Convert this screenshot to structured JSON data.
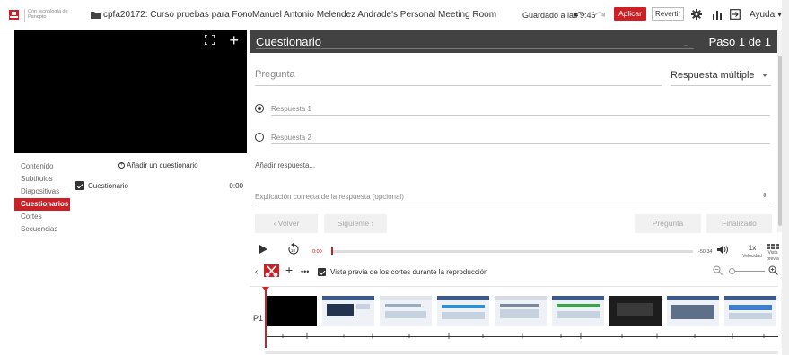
{
  "header": {
    "logo_text": "Con tecnología de Panopto",
    "folder": "cpfa20172: Curso pruebas para Fono",
    "separator": ">",
    "session": "Manuel Antonio Melendez Andrade's Personal Meeting Room",
    "saved_status": "Guardado a las 9:46",
    "apply_label": "Aplicar",
    "revert_label": "Revertir",
    "help_label": "Ayuda ▾",
    "accent_color": "#cc2027"
  },
  "sidebar": {
    "items": [
      {
        "label": "Contenido",
        "active": false
      },
      {
        "label": "Subtítulos",
        "active": false
      },
      {
        "label": "Diapositivas",
        "active": false
      },
      {
        "label": "Cuestionarios",
        "active": true
      },
      {
        "label": "Cortes",
        "active": false
      },
      {
        "label": "Secuencias",
        "active": false
      }
    ],
    "add_quiz_label": "Añadir un cuestionario",
    "quiz": {
      "label": "Cuestionario",
      "time": "0:00",
      "checked": true
    }
  },
  "quiz_editor": {
    "title": "Cuestionario",
    "step": "Paso 1 de 1",
    "question_placeholder": "Pregunta",
    "question_type": "Respuesta múltiple",
    "answers": [
      {
        "label": "Respuesta 1",
        "selected": true
      },
      {
        "label": "Respuesta 2",
        "selected": false
      }
    ],
    "add_answer": "Añadir respuesta...",
    "explanation_placeholder": "Explicación correcta de la respuesta (opcional)",
    "back_label": "‹  Volver",
    "next_label": "Siguiente  ›",
    "question_button": "Pregunta",
    "finish_button": "Finalizado"
  },
  "playback": {
    "current_time": "0:00",
    "end_time": "-50:34",
    "speed": "1x",
    "speed_label": "Velocidad",
    "preview_label": "Vista previa",
    "progress": 0
  },
  "editing": {
    "preview_cuts_label": "Vista previa de los cortes durante la reproducción",
    "preview_cuts_checked": true
  },
  "timeline": {
    "track_label": "P1"
  }
}
